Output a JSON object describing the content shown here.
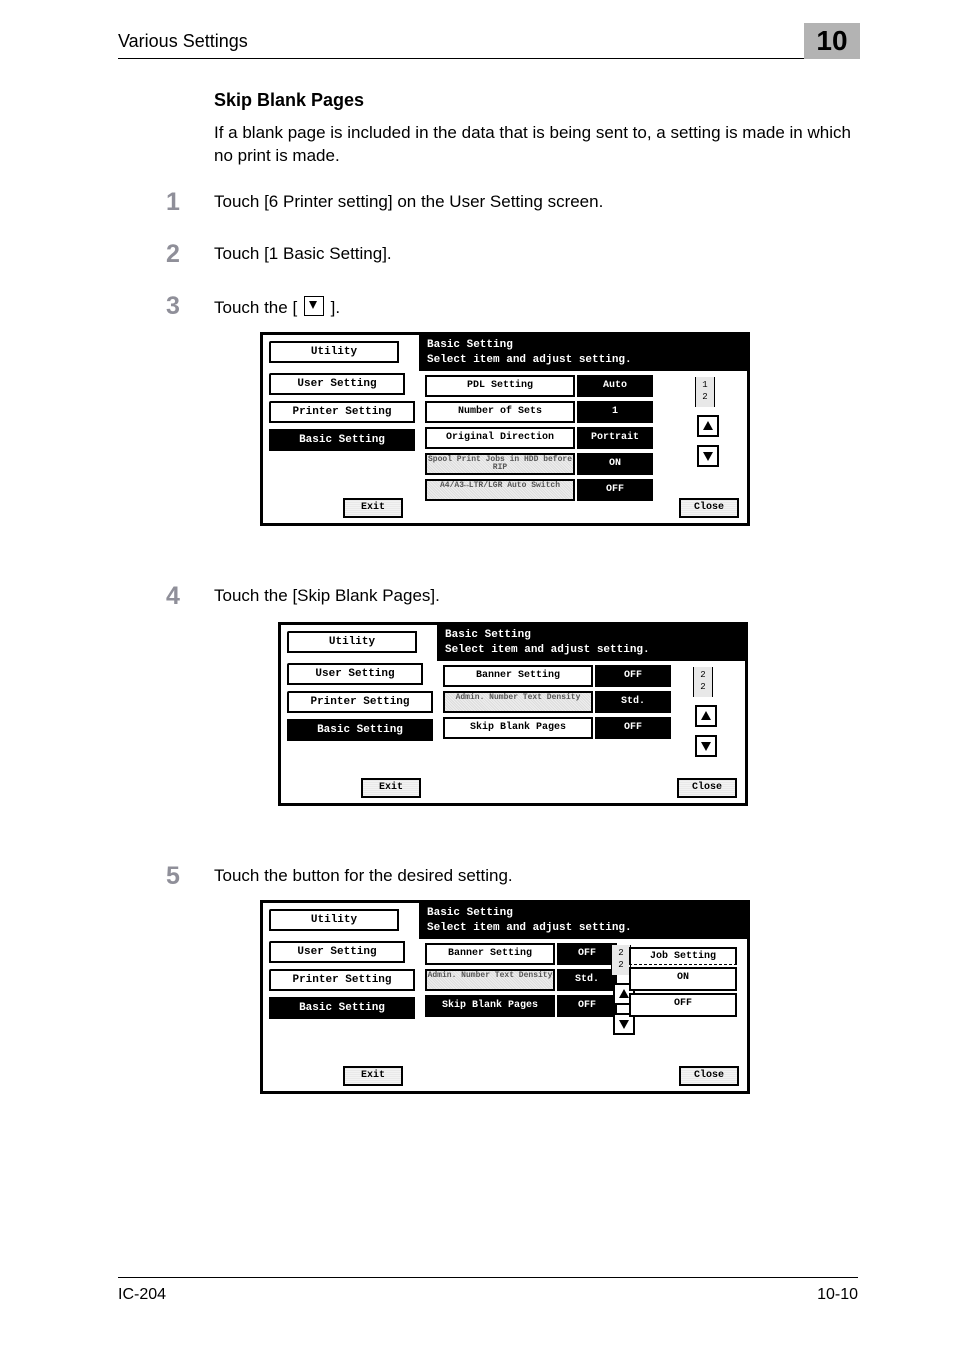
{
  "header": {
    "title": "Various Settings",
    "chapter": "10"
  },
  "section_title": "Skip Blank Pages",
  "intro_para": "If a blank page is included in the data that is being sent to, a setting is made in which no print is made.",
  "steps": {
    "s1": {
      "num": "1",
      "text": "Touch [6 Printer setting] on the User Setting screen."
    },
    "s2": {
      "num": "2",
      "text": "Touch [1 Basic Setting]."
    },
    "s3": {
      "num": "3",
      "text_before": "Touch the [",
      "text_after": " ]."
    },
    "s4": {
      "num": "4",
      "text": "Touch the [Skip Blank Pages]."
    },
    "s5": {
      "num": "5",
      "text": "Touch the button for the desired setting."
    }
  },
  "labels": {
    "exit": "Exit",
    "close": "Close",
    "titlebar_line1": "Basic Setting",
    "titlebar_line2": "Select item and adjust setting."
  },
  "crumbs": {
    "utility": "Utility",
    "user_setting": "User Setting",
    "printer_setting": "Printer Setting",
    "basic_setting": "Basic Setting"
  },
  "shot1": {
    "pdl_setting": "PDL Setting",
    "pdl_val": "Auto",
    "num_sets": "Number of Sets",
    "num_sets_val": "1",
    "orig_dir": "Original Direction",
    "orig_dir_val": "Portrait",
    "spool": "Spool Print Jobs in HDD before RIP",
    "spool_val": "ON",
    "a4": "A4/A3↔LTR/LGR Auto Switch",
    "a4_val": "OFF",
    "page_ind": "1\n2"
  },
  "shot2": {
    "banner": "Banner Setting",
    "banner_val": "OFF",
    "admin": "Admin. Number Text Density",
    "admin_val": "Std.",
    "skip": "Skip Blank Pages",
    "skip_val": "OFF",
    "page_ind": "2\n2"
  },
  "shot3": {
    "banner": "Banner Setting",
    "banner_val": "OFF",
    "admin": "Admin. Number Text Density",
    "admin_val": "Std.",
    "skip": "Skip Blank Pages",
    "skip_val": "OFF",
    "page_ind": "2\n2",
    "side_title": "Job Setting",
    "opt_on": "ON",
    "opt_off": "OFF"
  },
  "footer": {
    "left": "IC-204",
    "right": "10-10"
  }
}
